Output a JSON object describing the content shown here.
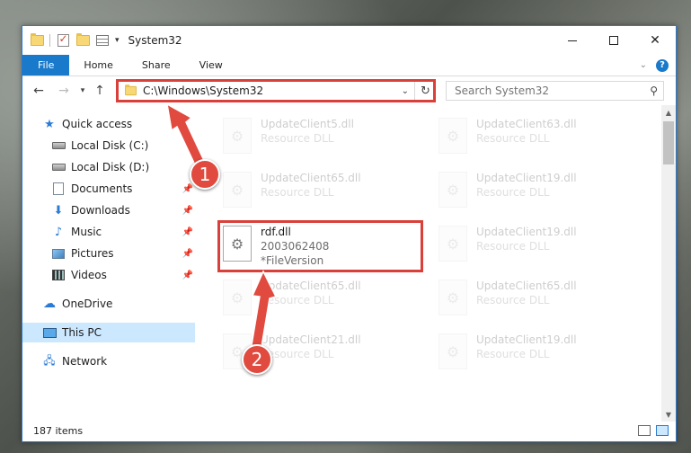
{
  "window": {
    "title": "System32"
  },
  "ribbon": {
    "tabs": [
      "File",
      "Home",
      "Share",
      "View"
    ]
  },
  "address": {
    "path": "C:\\Windows\\System32"
  },
  "search": {
    "placeholder": "Search System32"
  },
  "sidebar": {
    "quick_access": "Quick access",
    "items": [
      "Local Disk (C:)",
      "Local Disk (D:)",
      "Documents",
      "Downloads",
      "Music",
      "Pictures",
      "Videos"
    ],
    "onedrive": "OneDrive",
    "this_pc": "This PC",
    "network": "Network"
  },
  "files": [
    {
      "name": "UpdateClient5.dll",
      "type": "Resource DLL"
    },
    {
      "name": "UpdateClient63.dll",
      "type": "Resource DLL"
    },
    {
      "name": "UpdateClient65.dll",
      "type": "Resource DLL"
    },
    {
      "name": "UpdateClient19.dll",
      "type": "Resource DLL"
    },
    {
      "name": "UpdateClient19.dll",
      "type": "Resource DLL"
    },
    {
      "name": "UpdateClient65.dll",
      "type": "Resource DLL"
    },
    {
      "name": "UpdateClient65.dll",
      "type": "Resource DLL"
    },
    {
      "name": "UpdateClient21.dll",
      "type": "Resource DLL"
    },
    {
      "name": "UpdateClient19.dll",
      "type": "Resource DLL"
    }
  ],
  "highlighted_file": {
    "name": "rdf.dll",
    "version": "2003062408",
    "subtitle": "*FileVersion"
  },
  "status": {
    "item_count": "187 items"
  },
  "annotations": {
    "step1": "1",
    "step2": "2",
    "color": "#e04a3f"
  }
}
